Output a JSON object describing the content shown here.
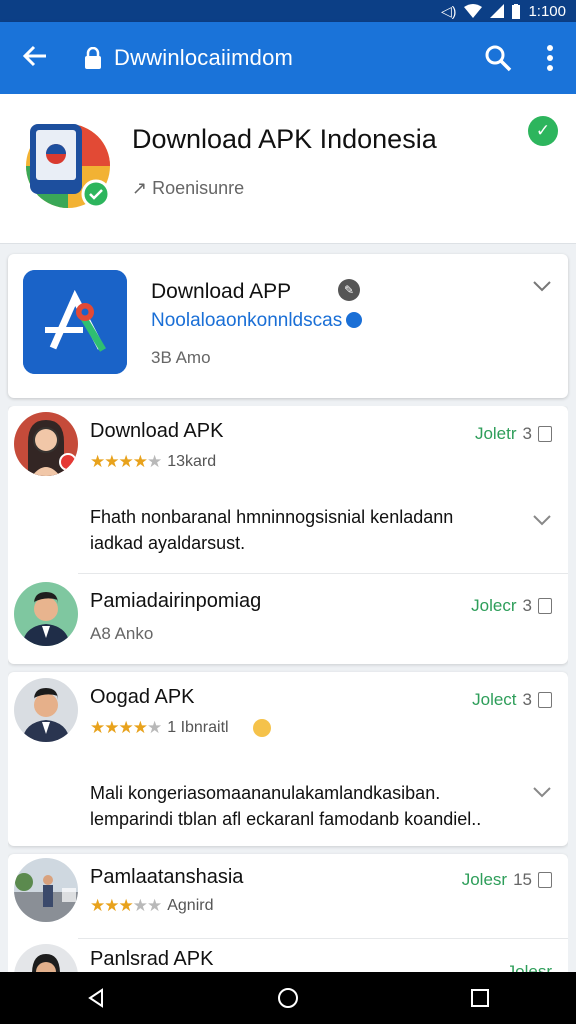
{
  "status_bar": {
    "time": "1:100",
    "icons": [
      "vibrate-icon",
      "wifi-icon",
      "signal-icon",
      "battery-icon"
    ]
  },
  "app_bar": {
    "title": "Dwwinlocaiimdom",
    "icons": [
      "back-arrow-icon",
      "lock-icon",
      "search-icon",
      "more-vert-icon"
    ]
  },
  "header": {
    "title": "Download APK Indonesia",
    "subtitle": "Roenisunre",
    "prefix_symbol": "↗"
  },
  "app_card": {
    "name": "Download APP",
    "developer": "Noolaloaonkonnldscas",
    "meta": "3B Amo"
  },
  "reviews": [
    {
      "name": "Download APK",
      "stars": 3.5,
      "rating_text": "13kard",
      "status": "Joletr",
      "count": "3",
      "body_line1": "Fhath nonbaranal hmninnogsisnial kenladann",
      "body_line2": "iadkad ayaldarsust."
    },
    {
      "name": "Pamiadairinpomiag",
      "status": "Jolecr",
      "count": "3",
      "meta": "A8 Anko"
    },
    {
      "name": "Oogad APK",
      "stars": 4,
      "rating_text": "1 Ibnraitl",
      "status": "Jolect",
      "count": "3",
      "body_line1": "Mali kongeriasomaananulakamlandkasiban.",
      "body_line2": "lemparindi tblan afl eckaranl famodanb koandiel.."
    },
    {
      "name": "Pamlaatanshasia",
      "stars": 3,
      "rating_text": "Agnird",
      "status": "Jolesr",
      "count": "15"
    },
    {
      "name": "Panlsrad APK",
      "status": "Jolesr"
    }
  ],
  "colors": {
    "app_bar": "#1a73d9",
    "status_bar": "#0c3f86",
    "accent_green": "#2db55d",
    "link_blue": "#1a6fd6",
    "star": "#e8a21c"
  },
  "nav_bar": {
    "icons": [
      "back-triangle-icon",
      "home-circle-icon",
      "recents-square-icon"
    ]
  }
}
